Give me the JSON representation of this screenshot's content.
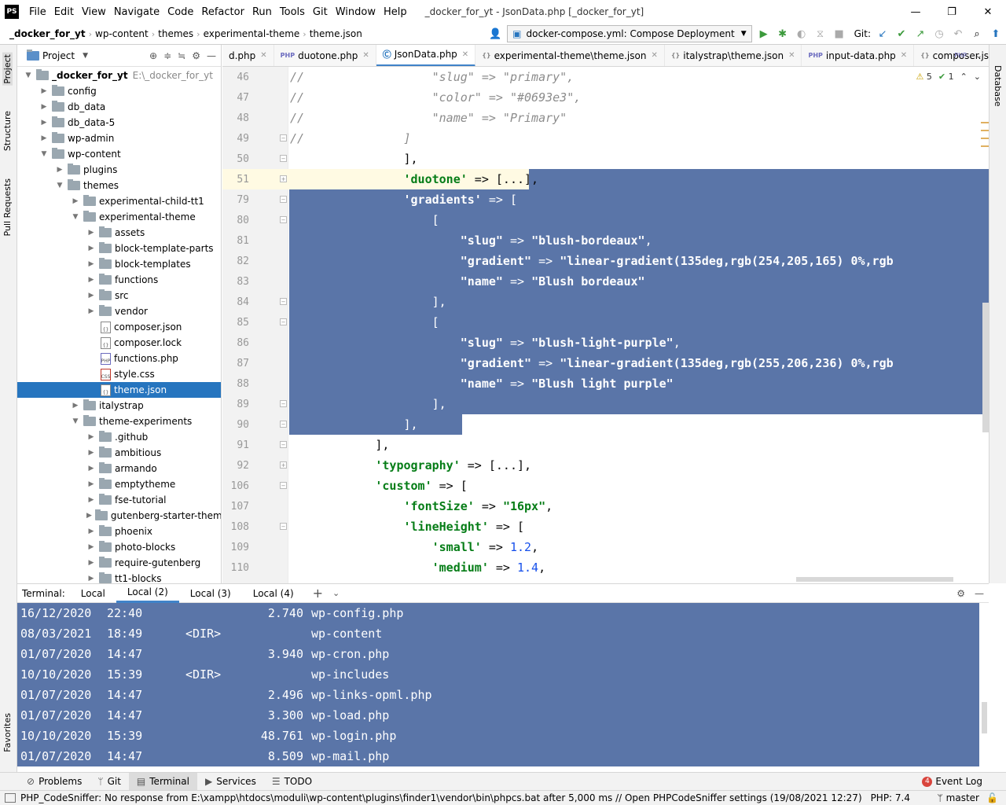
{
  "app": {
    "logo": "PS",
    "window_title": "_docker_for_yt - JsonData.php [_docker_for_yt]"
  },
  "menu": [
    "File",
    "Edit",
    "View",
    "Navigate",
    "Code",
    "Refactor",
    "Run",
    "Tools",
    "Git",
    "Window",
    "Help"
  ],
  "window_controls": {
    "minimize": "—",
    "maximize": "❐",
    "close": "✕"
  },
  "breadcrumb": [
    "_docker_for_yt",
    "wp-content",
    "themes",
    "experimental-theme",
    "theme.json"
  ],
  "run_config": "docker-compose.yml: Compose Deployment",
  "git_label": "Git:",
  "left_strip": {
    "project": "Project",
    "structure": "Structure",
    "pull_requests": "Pull Requests",
    "favorites": "Favorites"
  },
  "right_strip": {
    "database": "Database"
  },
  "project_panel": {
    "title": "Project"
  },
  "tree": [
    {
      "label": "_docker_for_yt",
      "hint": "E:\\_docker_for_yt",
      "depth": 0,
      "open": true,
      "type": "folder",
      "bold": true
    },
    {
      "label": "config",
      "depth": 1,
      "open": false,
      "type": "folder"
    },
    {
      "label": "db_data",
      "depth": 1,
      "open": false,
      "type": "folder"
    },
    {
      "label": "db_data-5",
      "depth": 1,
      "open": false,
      "type": "folder"
    },
    {
      "label": "wp-admin",
      "depth": 1,
      "open": false,
      "type": "folder"
    },
    {
      "label": "wp-content",
      "depth": 1,
      "open": true,
      "type": "folder"
    },
    {
      "label": "plugins",
      "depth": 2,
      "open": false,
      "type": "folder"
    },
    {
      "label": "themes",
      "depth": 2,
      "open": true,
      "type": "folder"
    },
    {
      "label": "experimental-child-tt1",
      "depth": 3,
      "open": false,
      "type": "folder"
    },
    {
      "label": "experimental-theme",
      "depth": 3,
      "open": true,
      "type": "folder"
    },
    {
      "label": "assets",
      "depth": 4,
      "open": false,
      "type": "folder"
    },
    {
      "label": "block-template-parts",
      "depth": 4,
      "open": false,
      "type": "folder"
    },
    {
      "label": "block-templates",
      "depth": 4,
      "open": false,
      "type": "folder"
    },
    {
      "label": "functions",
      "depth": 4,
      "open": false,
      "type": "folder"
    },
    {
      "label": "src",
      "depth": 4,
      "open": false,
      "type": "folder"
    },
    {
      "label": "vendor",
      "depth": 4,
      "open": false,
      "type": "folder"
    },
    {
      "label": "composer.json",
      "depth": 4,
      "type": "json"
    },
    {
      "label": "composer.lock",
      "depth": 4,
      "type": "json"
    },
    {
      "label": "functions.php",
      "depth": 4,
      "type": "php"
    },
    {
      "label": "style.css",
      "depth": 4,
      "type": "css"
    },
    {
      "label": "theme.json",
      "depth": 4,
      "type": "json",
      "selected": true
    },
    {
      "label": "italystrap",
      "depth": 3,
      "open": false,
      "type": "folder"
    },
    {
      "label": "theme-experiments",
      "depth": 3,
      "open": true,
      "type": "folder"
    },
    {
      "label": ".github",
      "depth": 4,
      "open": false,
      "type": "folder"
    },
    {
      "label": "ambitious",
      "depth": 4,
      "open": false,
      "type": "folder"
    },
    {
      "label": "armando",
      "depth": 4,
      "open": false,
      "type": "folder"
    },
    {
      "label": "emptytheme",
      "depth": 4,
      "open": false,
      "type": "folder"
    },
    {
      "label": "fse-tutorial",
      "depth": 4,
      "open": false,
      "type": "folder"
    },
    {
      "label": "gutenberg-starter-theme-b",
      "depth": 4,
      "open": false,
      "type": "folder"
    },
    {
      "label": "phoenix",
      "depth": 4,
      "open": false,
      "type": "folder"
    },
    {
      "label": "photo-blocks",
      "depth": 4,
      "open": false,
      "type": "folder"
    },
    {
      "label": "require-gutenberg",
      "depth": 4,
      "open": false,
      "type": "folder"
    },
    {
      "label": "tt1-blocks",
      "depth": 4,
      "open": false,
      "type": "folder"
    }
  ],
  "editor_tabs": [
    {
      "label": "d.php",
      "icon": "php",
      "active": false
    },
    {
      "label": "duotone.php",
      "icon": "php",
      "active": false
    },
    {
      "label": "JsonData.php",
      "icon": "class",
      "active": true
    },
    {
      "label": "experimental-theme\\theme.json",
      "icon": "json",
      "active": false
    },
    {
      "label": "italystrap\\theme.json",
      "icon": "json",
      "active": false
    },
    {
      "label": "input-data.php",
      "icon": "php",
      "active": false
    },
    {
      "label": "composer.json",
      "icon": "json",
      "active": false
    }
  ],
  "inspections": {
    "warnings": "5",
    "ok": "1"
  },
  "code_lines": [
    {
      "n": "46",
      "html": "<span class='cm'>//                  \"slug\" =&gt; \"primary\",</span>"
    },
    {
      "n": "47",
      "html": "<span class='cm'>//                  \"color\" =&gt; \"#0693e3\",</span>"
    },
    {
      "n": "48",
      "html": "<span class='cm'>//                  \"name\" =&gt; \"Primary\"</span>"
    },
    {
      "n": "49",
      "html": "<span class='cm'>//              ]</span>"
    },
    {
      "n": "50",
      "html": "                ],"
    },
    {
      "n": "51",
      "html": "                <span class='str'>'duotone'</span> =&gt; [...],"
    },
    {
      "n": "79",
      "html": "                <span class='str'>'gradients'</span> =&gt; ["
    },
    {
      "n": "80",
      "html": "                    ["
    },
    {
      "n": "81",
      "html": "                        <span class='str'>\"slug\"</span> =&gt; <span class='str'>\"blush-bordeaux\"</span>,"
    },
    {
      "n": "82",
      "html": "                        <span class='str'>\"gradient\"</span> =&gt; <span class='str'>\"linear-gradient(135deg,rgb(254,205,165) 0%,rgb</span>"
    },
    {
      "n": "83",
      "html": "                        <span class='str'>\"name\"</span> =&gt; <span class='str'>\"Blush bordeaux\"</span>"
    },
    {
      "n": "84",
      "html": "                    ],"
    },
    {
      "n": "85",
      "html": "                    ["
    },
    {
      "n": "86",
      "html": "                        <span class='str'>\"slug\"</span> =&gt; <span class='str'>\"blush-light-purple\"</span>,"
    },
    {
      "n": "87",
      "html": "                        <span class='str'>\"gradient\"</span> =&gt; <span class='str'>\"linear-gradient(135deg,rgb(255,206,236) 0%,rgb</span>"
    },
    {
      "n": "88",
      "html": "                        <span class='str'>\"name\"</span> =&gt; <span class='str'>\"Blush light purple\"</span>"
    },
    {
      "n": "89",
      "html": "                    ],"
    },
    {
      "n": "90",
      "html": "                ],"
    },
    {
      "n": "91",
      "html": "            ],"
    },
    {
      "n": "92",
      "html": "            <span class='str'>'typography'</span> =&gt; [...],"
    },
    {
      "n": "106",
      "html": "            <span class='str'>'custom'</span> =&gt; ["
    },
    {
      "n": "107",
      "html": "                <span class='str'>'fontSize'</span> =&gt; <span class='str'>\"16px\"</span>,"
    },
    {
      "n": "108",
      "html": "                <span class='str'>'lineHeight'</span> =&gt; ["
    },
    {
      "n": "109",
      "html": "                    <span class='str'>'small'</span> =&gt; <span class='num'>1.2</span>,"
    },
    {
      "n": "110",
      "html": "                    <span class='str'>'medium'</span> =&gt; <span class='num'>1.4</span>,"
    }
  ],
  "terminal": {
    "label": "Terminal:",
    "tabs": [
      "Local",
      "Local (2)",
      "Local (3)",
      "Local (4)"
    ],
    "active_tab": "Local (2)",
    "rows": [
      {
        "date": "16/12/2020",
        "time": "22:40",
        "dir": "",
        "size": "2.740",
        "name": "wp-config.php"
      },
      {
        "date": "08/03/2021",
        "time": "18:49",
        "dir": "<DIR>",
        "size": "",
        "name": "wp-content"
      },
      {
        "date": "01/07/2020",
        "time": "14:47",
        "dir": "",
        "size": "3.940",
        "name": "wp-cron.php"
      },
      {
        "date": "10/10/2020",
        "time": "15:39",
        "dir": "<DIR>",
        "size": "",
        "name": "wp-includes"
      },
      {
        "date": "01/07/2020",
        "time": "14:47",
        "dir": "",
        "size": "2.496",
        "name": "wp-links-opml.php"
      },
      {
        "date": "01/07/2020",
        "time": "14:47",
        "dir": "",
        "size": "3.300",
        "name": "wp-load.php"
      },
      {
        "date": "10/10/2020",
        "time": "15:39",
        "dir": "",
        "size": "48.761",
        "name": "wp-login.php"
      },
      {
        "date": "01/07/2020",
        "time": "14:47",
        "dir": "",
        "size": "8.509",
        "name": "wp-mail.php"
      }
    ]
  },
  "tool_windows": [
    {
      "label": "Problems",
      "icon": "⊘"
    },
    {
      "label": "Git",
      "icon": "ᛘ"
    },
    {
      "label": "Terminal",
      "icon": "▤",
      "active": true
    },
    {
      "label": "Services",
      "icon": "▶"
    },
    {
      "label": "TODO",
      "icon": "☰"
    }
  ],
  "event_log": {
    "count": "4",
    "label": "Event Log"
  },
  "status": {
    "message": "PHP_CodeSniffer: No response from E:\\xampp\\htdocs\\moduli\\wp-content\\plugins\\finder1\\vendor\\bin\\phpcs.bat after 5,000 ms // Open PHPCodeSniffer settings (19/08/2021 12:27)",
    "php": "PHP: 7.4",
    "branch": "master"
  },
  "colors": {
    "selection": "#5a75a8",
    "accent": "#4083c9",
    "tree_selected": "#2675bf",
    "string": "#067d17",
    "number": "#1750eb",
    "comment": "#8c8c8c"
  }
}
